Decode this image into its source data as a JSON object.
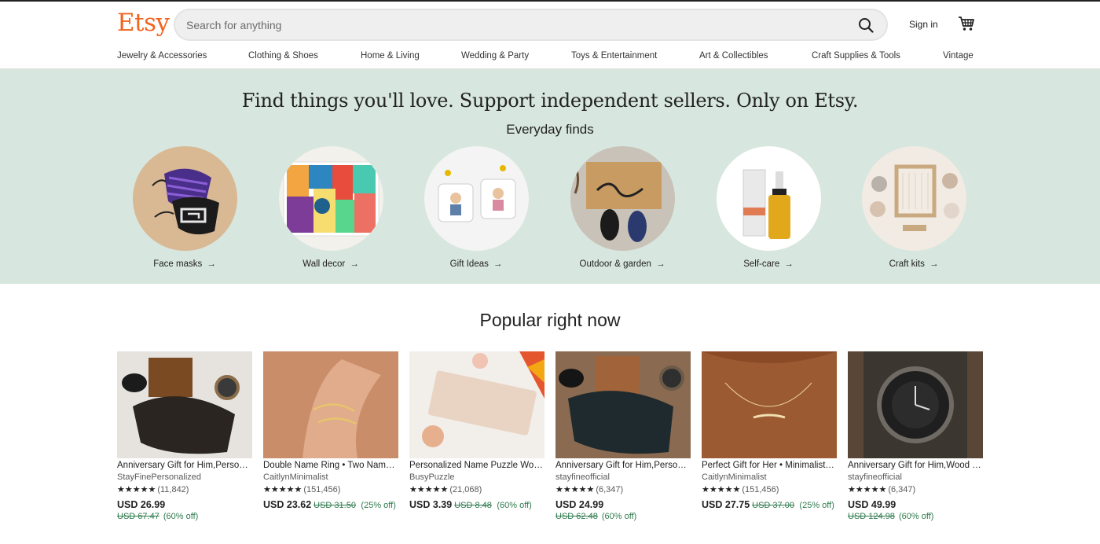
{
  "header": {
    "logo": "Etsy",
    "search_placeholder": "Search for anything",
    "sign_in": "Sign in",
    "search_icon": "search-icon",
    "cart_icon": "cart-icon"
  },
  "nav": [
    "Jewelry & Accessories",
    "Clothing & Shoes",
    "Home & Living",
    "Wedding & Party",
    "Toys & Entertainment",
    "Art & Collectibles",
    "Craft Supplies & Tools",
    "Vintage"
  ],
  "hero": {
    "title": "Find things you'll love. Support independent sellers. Only on Etsy.",
    "subtitle": "Everyday finds",
    "items": [
      {
        "label": "Face masks"
      },
      {
        "label": "Wall decor"
      },
      {
        "label": "Gift Ideas"
      },
      {
        "label": "Outdoor & garden"
      },
      {
        "label": "Self-care"
      },
      {
        "label": "Craft kits"
      }
    ],
    "arrow": "→"
  },
  "popular": {
    "title": "Popular right now",
    "items": [
      {
        "title": "Anniversary Gift for Him,Personalized Wallet",
        "shop": "StayFinePersonalized",
        "stars": "★★★★★",
        "count": "(11,842)",
        "price": "USD 26.99",
        "original": "USD 67.47",
        "discount": "(60% off)",
        "discount_below": true
      },
      {
        "title": "Double Name Ring • Two Name Ring",
        "shop": "CaitlynMinimalist",
        "stars": "★★★★★",
        "count": "(151,456)",
        "price": "USD 23.62",
        "original": "USD 31.50",
        "discount": "(25% off)",
        "discount_below": false
      },
      {
        "title": "Personalized Name Puzzle Wooden",
        "shop": "BusyPuzzle",
        "stars": "★★★★★",
        "count": "(21,068)",
        "price": "USD 3.39",
        "original": "USD 8.48",
        "discount": "(60% off)",
        "discount_below": false
      },
      {
        "title": "Anniversary Gift for Him,Personalized Wallet",
        "shop": "stayfineofficial",
        "stars": "★★★★★",
        "count": "(6,347)",
        "price": "USD 24.99",
        "original": "USD 62.48",
        "discount": "(60% off)",
        "discount_below": true
      },
      {
        "title": "Perfect Gift for Her • Minimalist Name Necklace",
        "shop": "CaitlynMinimalist",
        "stars": "★★★★★",
        "count": "(151,456)",
        "price": "USD 27.75",
        "original": "USD 37.00",
        "discount": "(25% off)",
        "discount_below": false
      },
      {
        "title": "Anniversary Gift for Him,Wood Watch",
        "shop": "stayfineofficial",
        "stars": "★★★★★",
        "count": "(6,347)",
        "price": "USD 49.99",
        "original": "USD 124.98",
        "discount": "(60% off)",
        "discount_below": true
      }
    ]
  },
  "colors": {
    "brand": "#F1641E",
    "hero_bg": "#d7e6de",
    "discount": "#2f7a4e"
  }
}
